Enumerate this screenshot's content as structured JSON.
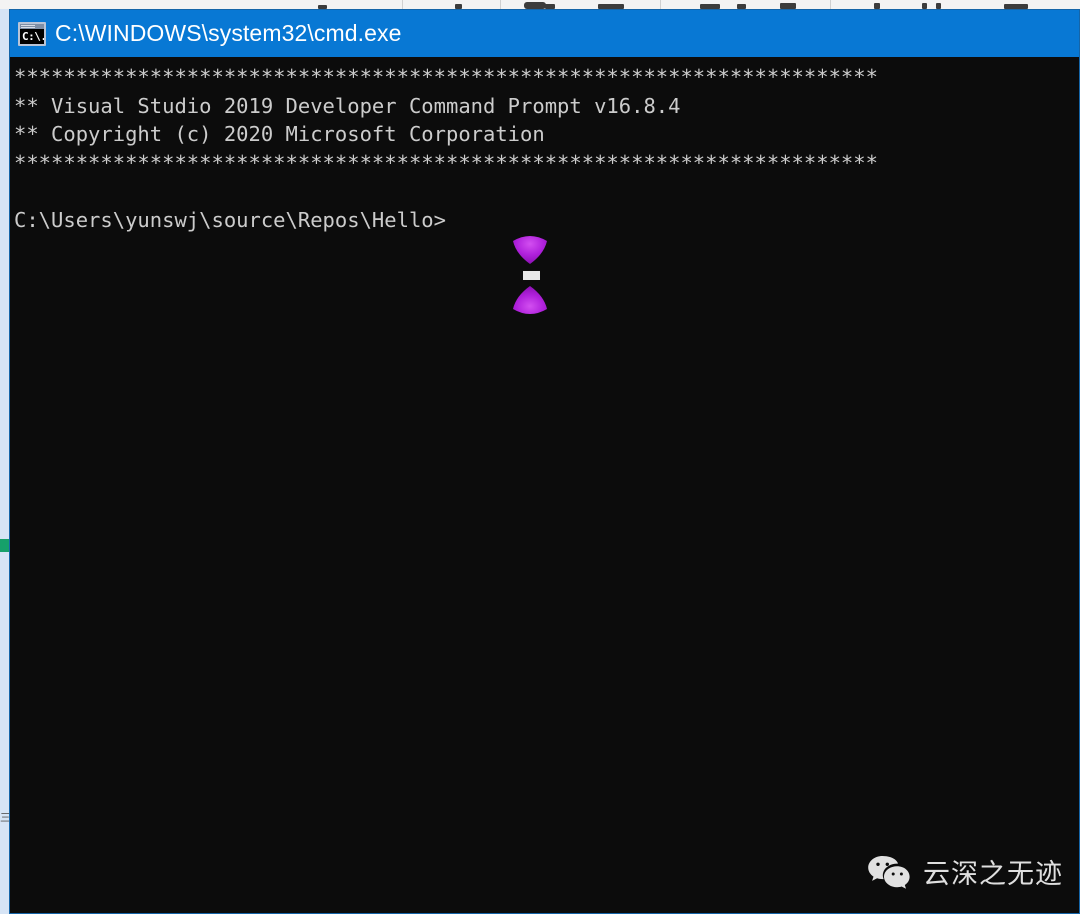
{
  "window": {
    "title": "C:\\WINDOWS\\system32\\cmd.exe",
    "icon": "cmd-console-icon",
    "icon_glyph": "C:\\.",
    "titlebar_color": "#0878d4",
    "background_color": "#0c0c0c",
    "text_color": "#cccccc",
    "border_color": "#1565a8"
  },
  "console": {
    "lines": [
      "**********************************************************************",
      "** Visual Studio 2019 Developer Command Prompt v16.8.4",
      "** Copyright (c) 2020 Microsoft Corporation",
      "**********************************************************************",
      "",
      "C:\\Users\\yunswj\\source\\Repos\\Hello>"
    ],
    "banner_line": "**********************************************************************",
    "product_line": "** Visual Studio 2019 Developer Command Prompt v16.8.4",
    "copyright_line": "** Copyright (c) 2020 Microsoft Corporation",
    "prompt": "C:\\Users\\yunswj\\source\\Repos\\Hello>",
    "product_name": "Visual Studio 2019 Developer Command Prompt",
    "version": "v16.8.4",
    "copyright_year": "2020",
    "copyright_holder": "Microsoft Corporation",
    "current_directory": "C:\\Users\\yunswj\\source\\Repos\\Hello",
    "user": "yunswj"
  },
  "annotation": {
    "color": "#a016c8",
    "top_marker": "cone-pointer-down",
    "bottom_marker": "cone-pointer-up",
    "target": "cursor-block"
  },
  "watermark": {
    "logo": "wechat-logo",
    "text": "云深之无迹"
  },
  "backdrop": {
    "strip_color": "#d6e4f5",
    "green_marker_color": "#16a06a",
    "faint_text": "三三"
  }
}
